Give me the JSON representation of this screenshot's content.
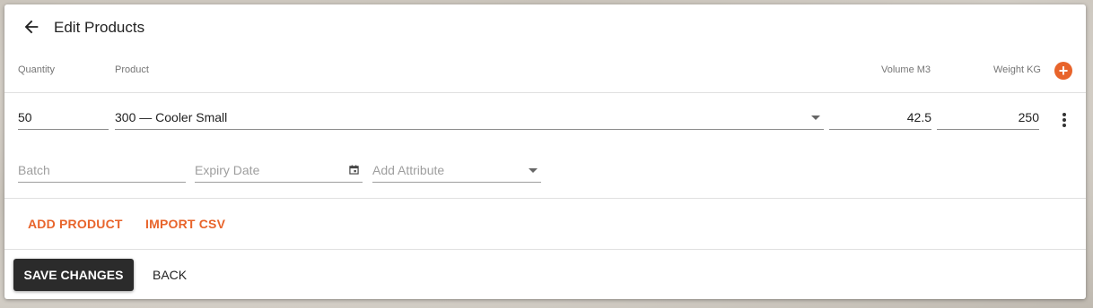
{
  "header": {
    "title": "Edit Products",
    "back_icon": "arrow-left-icon"
  },
  "columns": {
    "quantity": "Quantity",
    "product": "Product",
    "volume": "Volume M3",
    "weight": "Weight KG"
  },
  "row": {
    "quantity": "50",
    "product": "300 — Cooler Small",
    "volume": "42.5",
    "weight": "250"
  },
  "extra": {
    "batch_placeholder": "Batch",
    "expiry_placeholder": "Expiry Date",
    "attribute_placeholder": "Add Attribute"
  },
  "actions": {
    "add_product": "ADD PRODUCT",
    "import_csv": "IMPORT CSV"
  },
  "footer": {
    "save": "SAVE CHANGES",
    "back": "BACK"
  },
  "colors": {
    "accent": "#e8642b",
    "primary_button": "#2b2b2b"
  }
}
